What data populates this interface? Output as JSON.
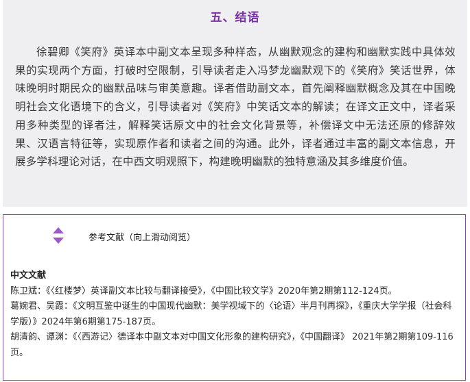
{
  "section": {
    "title": "五、结语",
    "paragraph": "徐碧卿《笑府》英译本中副文本呈现多种样态，从幽默观念的建构和幽默实践中具体效果的实现两个方面，打破时空限制，引导读者走入冯梦龙幽默观下的《笑府》笑话世界，体味晚明时期民众的幽默品味与审美意趣。译者借助副文本，首先阐释幽默概念及其在中国晚明社会文化语境下的含义，引导读者对《笑府》中笑话文本的解读；在译文正文中，译者采用多种类型的译者注，解释笑话原文中的社会文化背景等，补偿译文中无法还原的修辞效果、汉语言特征等，实现原作者和读者之间的沟通。此外，译者通过丰富的副文本信息，开展多学科理论对话，在中西文明观照下，构建晚明幽默的独特意涵及其多维度价值。"
  },
  "references": {
    "header": "参考文献（向上滑动阅览）",
    "category": "中文文献",
    "items": [
      "陈卫斌：《〈红楼梦〉英译副文本比较与翻译接受》，《中国比较文学》2020年第2期第112-124页。",
      "葛婉君、吴霞：《文明互鉴中诞生的中国现代幽默：美学视域下的〈论语〉半月刊再探》，《重庆大学学报（社会科学版）》2024年第6期第175-187页。",
      "胡清韵、谭渊：《〈西游记〉德译本中副文本对中国文化形象的建构研究》，《中国翻译》 2021年第2期第109-116页。"
    ]
  },
  "colors": {
    "accent": "#7a2ea8",
    "section_bg": "#efeff1",
    "border": "#8c3fb8"
  }
}
